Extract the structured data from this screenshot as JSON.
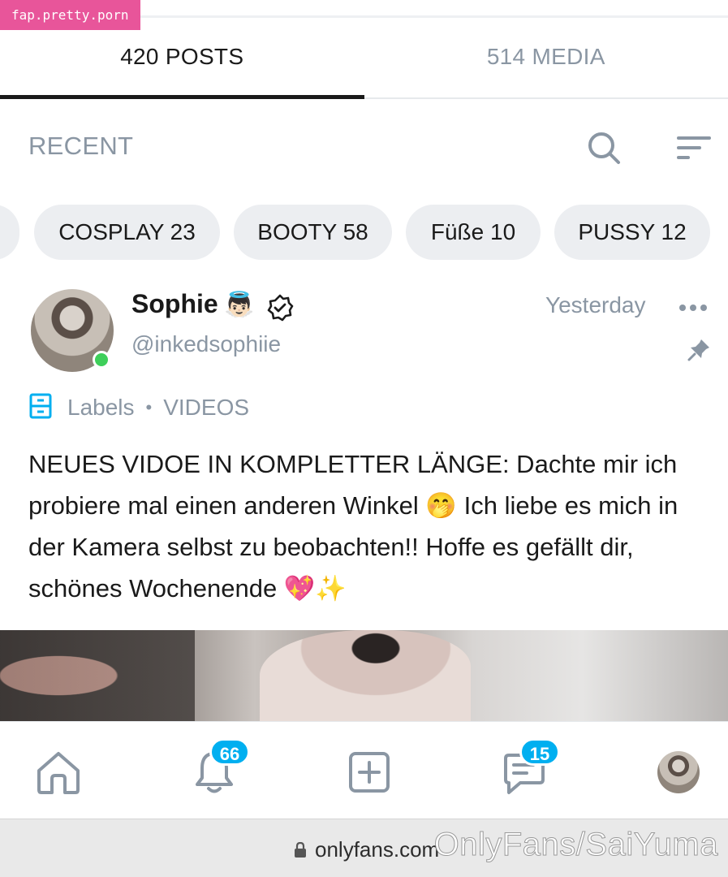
{
  "watermark_top": "fap.pretty.porn",
  "watermark_bottom": "OnlyFans/SaiYuma",
  "tabs": [
    {
      "label": "420 POSTS",
      "active": true
    },
    {
      "label": "514 MEDIA",
      "active": false
    }
  ],
  "recent": {
    "label": "RECENT",
    "search_icon": "search-icon",
    "sort_icon": "sort-icon"
  },
  "chips": [
    "COSPLAY 23",
    "BOOTY 58",
    "Füße 10",
    "PUSSY 12"
  ],
  "post": {
    "author_name": "Sophie",
    "author_emoji": "👼🏻",
    "verified_icon": "verified-icon",
    "handle": "@inkedsophiie",
    "time": "Yesterday",
    "labels_label": "Labels",
    "labels_separator": "•",
    "label_value": "VIDEOS",
    "text_part1": "NEUES VIDOE IN KOMPLETTER LÄNGE: Dachte mir ich probiere mal einen anderen Winkel",
    "emoji_mid": "🤭",
    "text_part2": "Ich liebe es mich in der Kamera selbst zu beobachten!! Hoffe es gefällt dir, schönes Wochenende",
    "emoji_end": "💖✨"
  },
  "bottom_nav": {
    "notifications_count": "66",
    "messages_count": "15"
  },
  "url_bar": {
    "url": "onlyfans.com"
  },
  "colors": {
    "accent": "#00aff0",
    "muted": "#8a96a3",
    "online": "#3ecf5a",
    "watermark_pink": "#e8559a"
  }
}
